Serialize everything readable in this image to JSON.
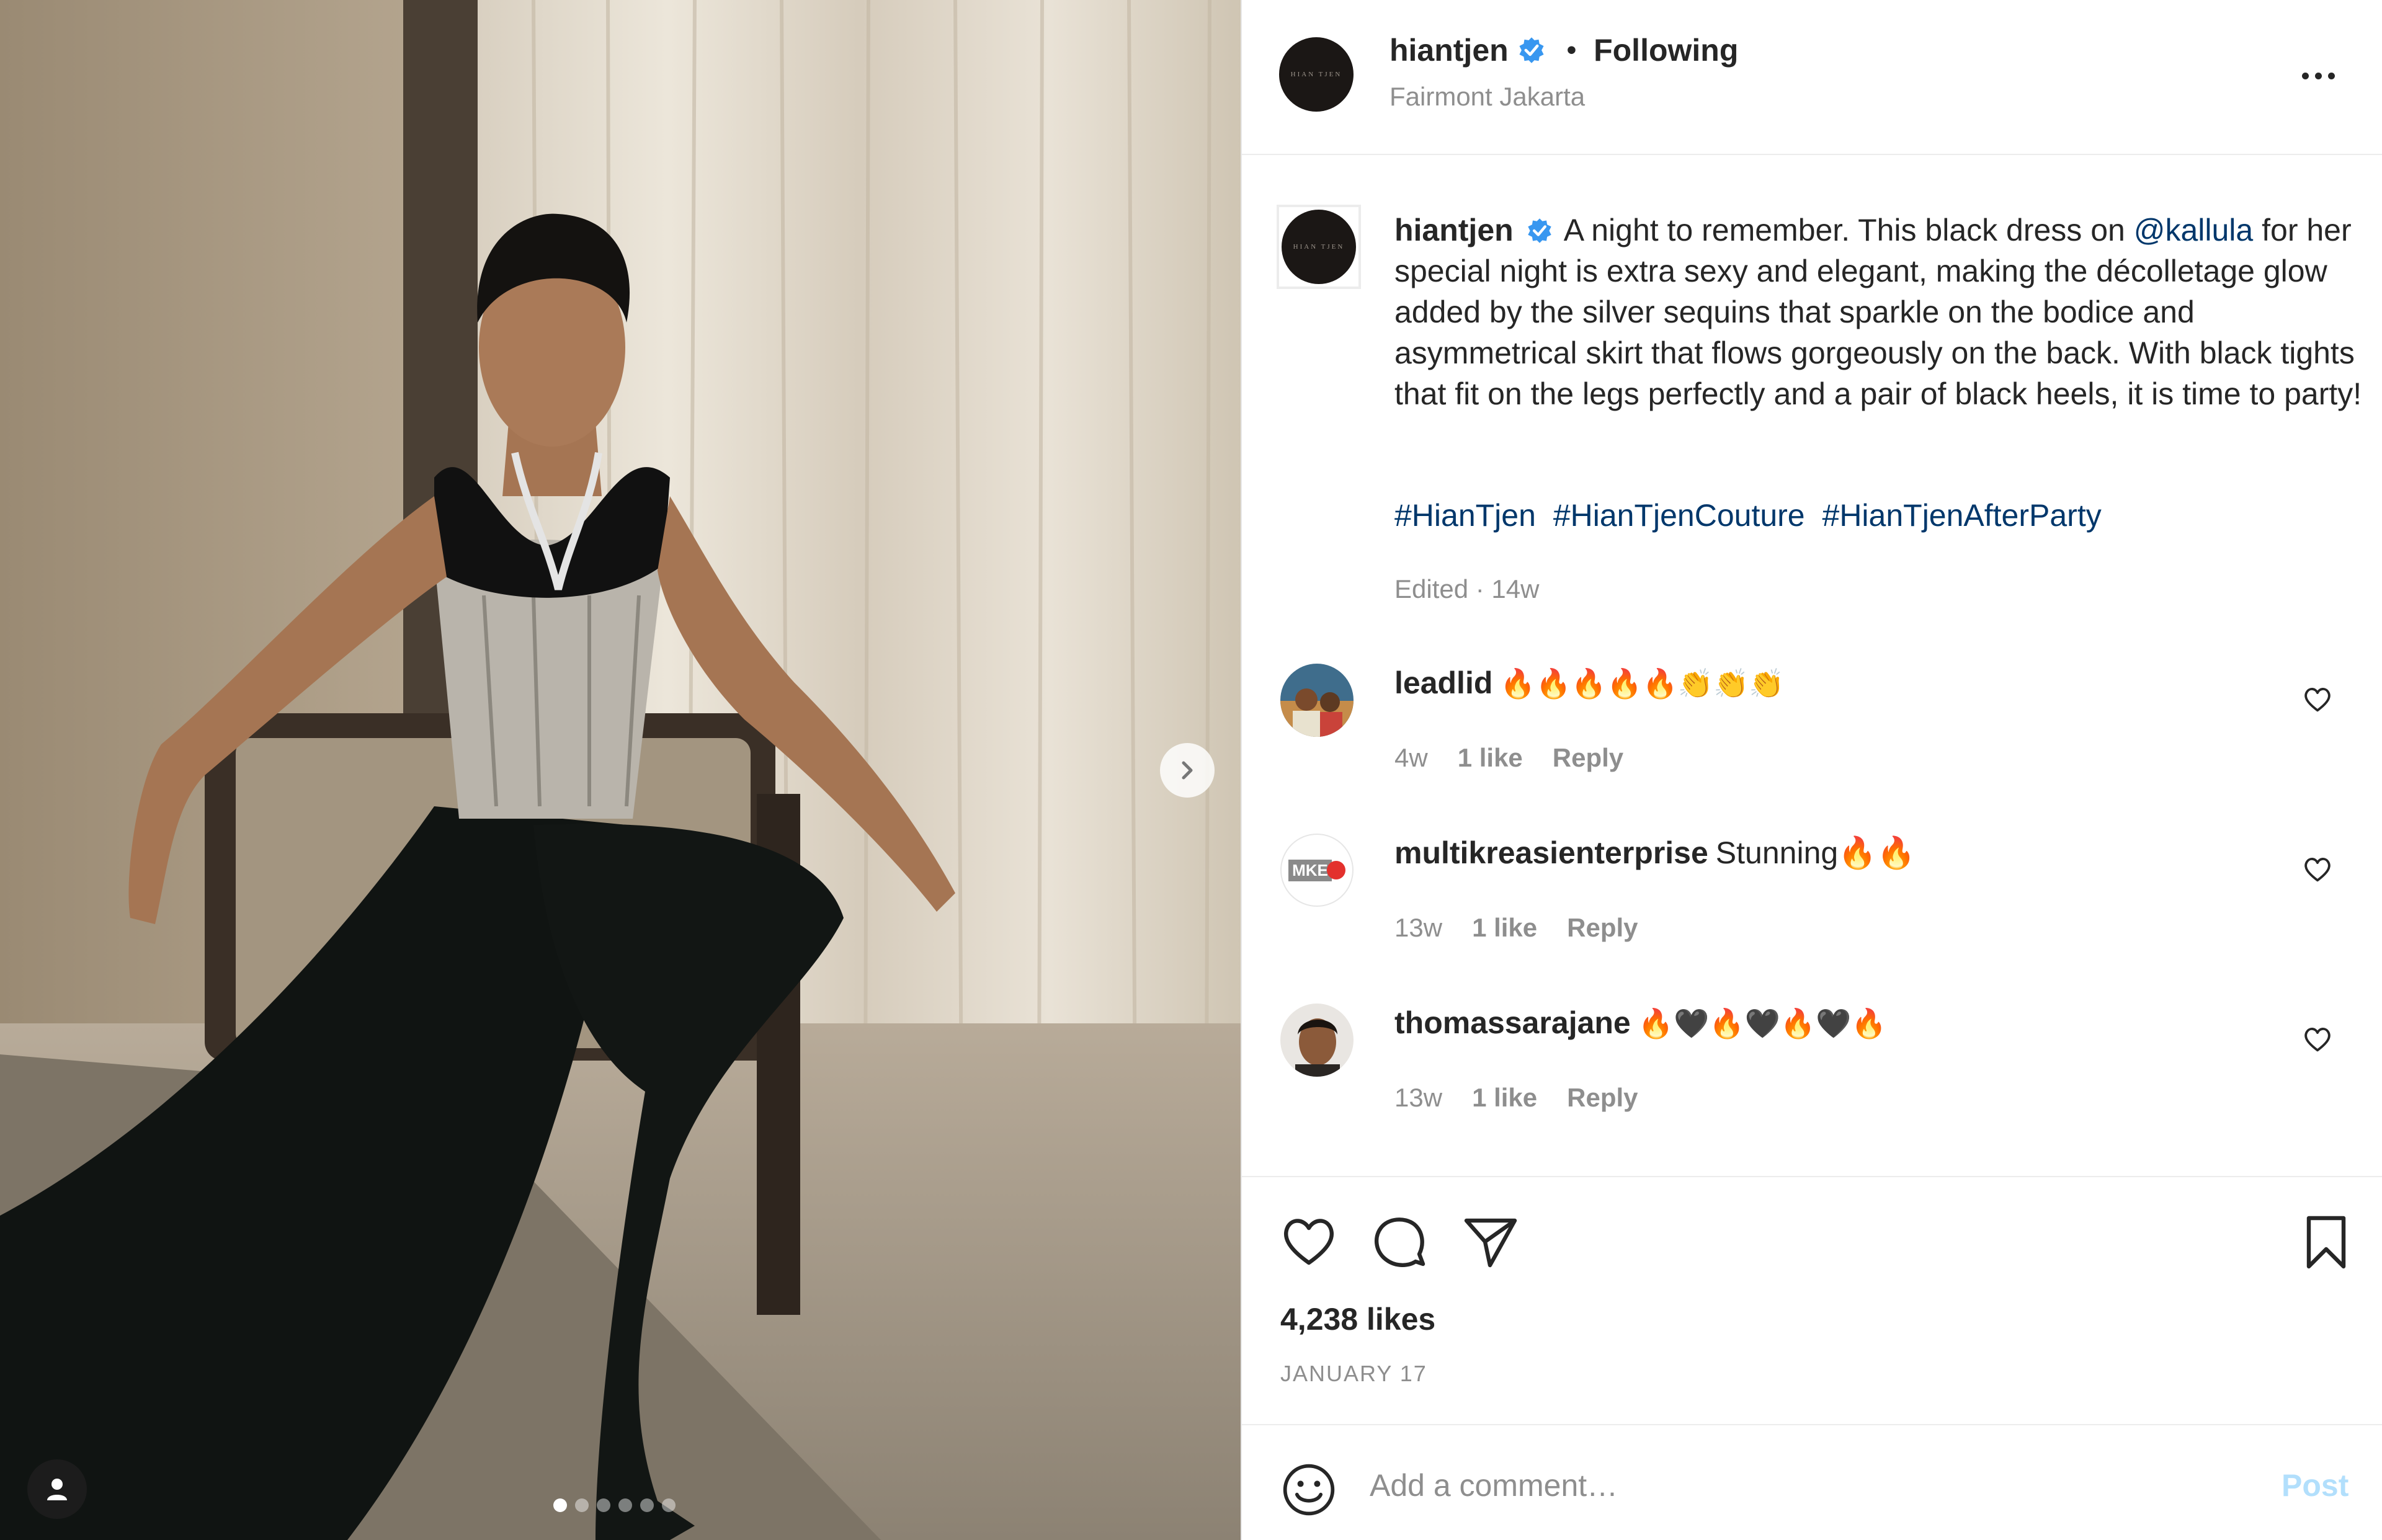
{
  "colors": {
    "link": "#00376b",
    "muted": "#8e8e8e",
    "verified": "#3897f0",
    "post_disabled": "#b2dffc"
  },
  "header": {
    "username": "hiantjen",
    "brand_text": "HIAN TJEN",
    "separator": "•",
    "follow_status": "Following",
    "location": "Fairmont Jakarta"
  },
  "caption": {
    "username": "hiantjen",
    "text_before": "A night to remember. This black dress on ",
    "mention": "@kallula",
    "text_after": " for her special night is extra sexy and elegant, making the décolletage glow added by the silver sequins that sparkle on the bodice and asymmetrical skirt that flows gorgeously on the back. With black tights that fit on the legs perfectly and a pair of black heels, it is time to party!",
    "hashtags": [
      "#HianTjen",
      "#HianTjenCouture",
      "#HianTjenAfterParty"
    ],
    "meta": "Edited · 14w"
  },
  "comments": [
    {
      "username": "leadlid",
      "text": "🔥🔥🔥🔥🔥👏👏👏",
      "time": "4w",
      "likes": "1 like",
      "reply": "Reply"
    },
    {
      "username": "multikreasienterprise",
      "text": "Stunning🔥🔥",
      "time": "13w",
      "likes": "1 like",
      "reply": "Reply",
      "avatar_text": "MKE"
    },
    {
      "username": "thomassarajane",
      "text": "🔥🖤🔥🖤🔥🖤🔥",
      "time": "13w",
      "likes": "1 like",
      "reply": "Reply"
    }
  ],
  "stats": {
    "likes": "4,238 likes",
    "date": "JANUARY 17"
  },
  "comment_box": {
    "placeholder": "Add a comment…",
    "post_label": "Post"
  },
  "carousel": {
    "total": 6,
    "active": 1
  }
}
